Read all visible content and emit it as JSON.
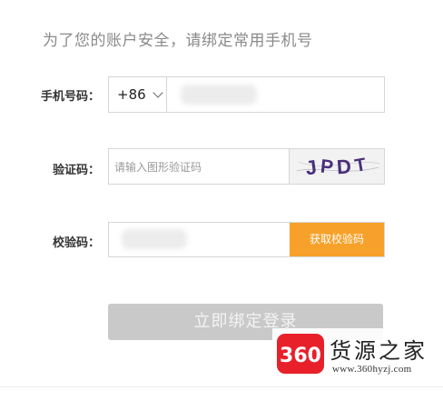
{
  "notice": "为了您的账户安全，请绑定常用手机号",
  "phone": {
    "label": "手机号码：",
    "country_code": "+86",
    "value_masked": ""
  },
  "captcha": {
    "label": "验证码：",
    "placeholder": "请输入图形验证码",
    "image_text": "JPDT"
  },
  "sms_code": {
    "label": "校验码：",
    "button_label": "获取校验码"
  },
  "submit": {
    "label": "立即绑定登录"
  },
  "watermark": {
    "logo_text": "360",
    "brand": "货源之家",
    "url": "www.360hyzj.com"
  },
  "colors": {
    "accent_orange": "#f7a12a",
    "disabled_button": "#c9c9c9",
    "watermark_red": "#e8202a"
  }
}
